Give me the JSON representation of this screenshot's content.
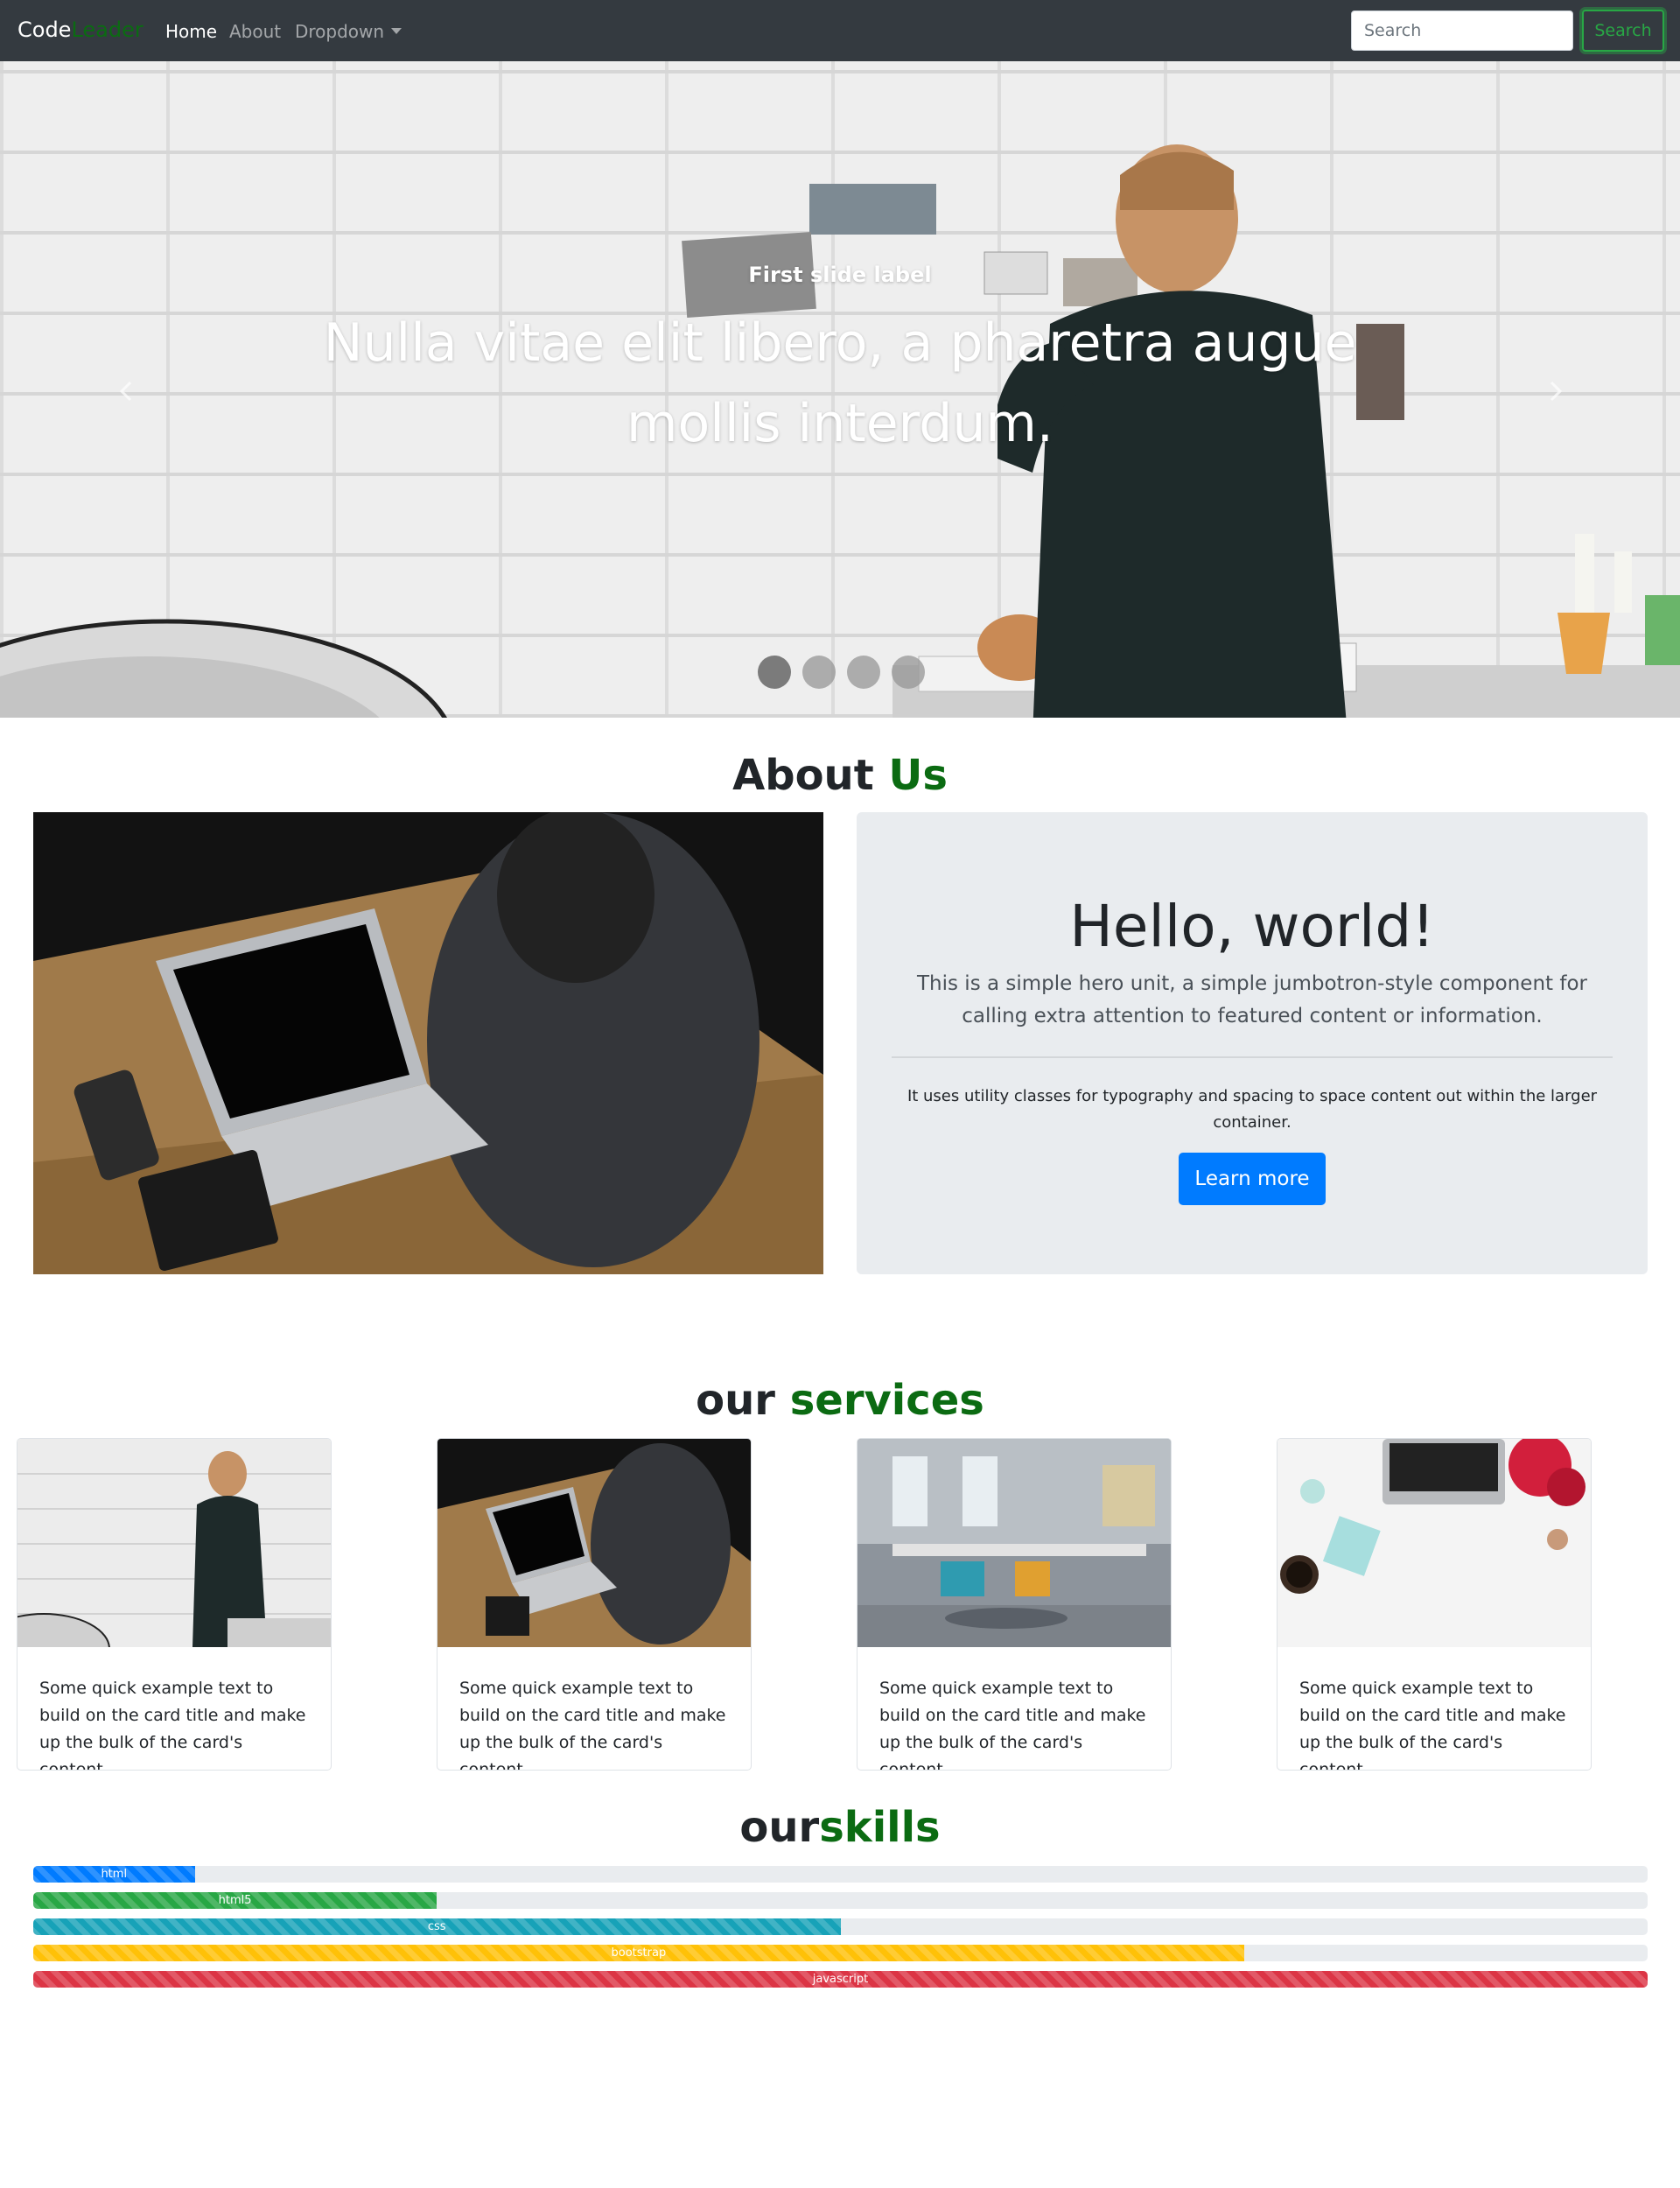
{
  "navbar": {
    "brand_main": "Code",
    "brand_accent": "Leader",
    "links": [
      {
        "label": "Home",
        "active": true
      },
      {
        "label": "About",
        "active": false
      },
      {
        "label": "Dropdown",
        "active": false
      }
    ],
    "search_placeholder": "Search",
    "search_button": "Search"
  },
  "carousel": {
    "caption_title": "First slide label",
    "caption_text": "Nulla vitae elit libero, a pharetra augue mollis interdum.",
    "slide_count": 4,
    "active_slide": 1
  },
  "about": {
    "title_main": "About",
    "title_accent": "Us",
    "jumbotron": {
      "heading": "Hello, world!",
      "lead": "This is a simple hero unit, a simple jumbotron-style component for calling extra attention to featured content or information.",
      "text": "It uses utility classes for typography and spacing to space content out within the larger container.",
      "button": "Learn more"
    }
  },
  "services": {
    "title_main": "our",
    "title_accent": "services",
    "cards": [
      {
        "text": "Some quick example text to build on the card title and make up the bulk of the card's content."
      },
      {
        "text": "Some quick example text to build on the card title and make up the bulk of the card's content."
      },
      {
        "text": "Some quick example text to build on the card title and make up the bulk of the card's content."
      },
      {
        "text": "Some quick example text to build on the card title and make up the bulk of the card's content."
      }
    ]
  },
  "skills": {
    "title_main": "our",
    "title_accent": "skills",
    "items": [
      {
        "label": "html",
        "percent": 10,
        "color": "#007bff"
      },
      {
        "label": "html5",
        "percent": 25,
        "color": "#28a745"
      },
      {
        "label": "css",
        "percent": 50,
        "color": "#17a2b8"
      },
      {
        "label": "bootstrap",
        "percent": 75,
        "color": "#ffc107"
      },
      {
        "label": "javascript",
        "percent": 100,
        "color": "#dc3545"
      }
    ]
  },
  "colors": {
    "navbar_bg": "#343a40",
    "accent_green": "#0b6b12",
    "primary": "#007bff",
    "jumbotron_bg": "#e9ecef"
  }
}
